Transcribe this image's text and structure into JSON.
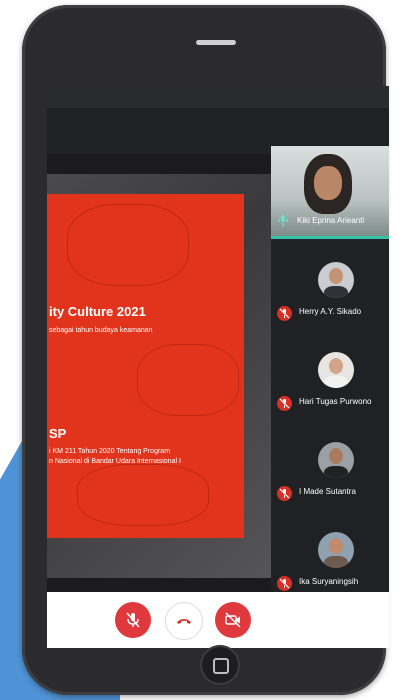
{
  "slide": {
    "title": "ity Culture 2021",
    "subtitle": "sebagai tahun budaya keamanan",
    "heading2": "SP",
    "line1": "i KM 211 Tahun 2020 Tentang Program",
    "line2": "n Nasional di Bandar Udara Internasional I"
  },
  "participants": {
    "active": {
      "name": "Kiki Eprina Arieanti",
      "mic": "mic-on"
    },
    "list": [
      {
        "name": "Herry A.Y. Sikado",
        "mic": "muted"
      },
      {
        "name": "Hari Tugas Purwono",
        "mic": "muted"
      },
      {
        "name": "I Made Sutantra",
        "mic": "muted"
      },
      {
        "name": "Ika Suryaningsih",
        "mic": "muted"
      }
    ]
  },
  "controls": {
    "mic": "mic-off-icon",
    "hangup": "hang-up-icon",
    "camera": "camera-off-icon"
  },
  "colors": {
    "slide_red": "#e2341c",
    "control_red": "#e0393d",
    "active_border": "#36c0a8",
    "background_blue": "#4f93d6"
  }
}
